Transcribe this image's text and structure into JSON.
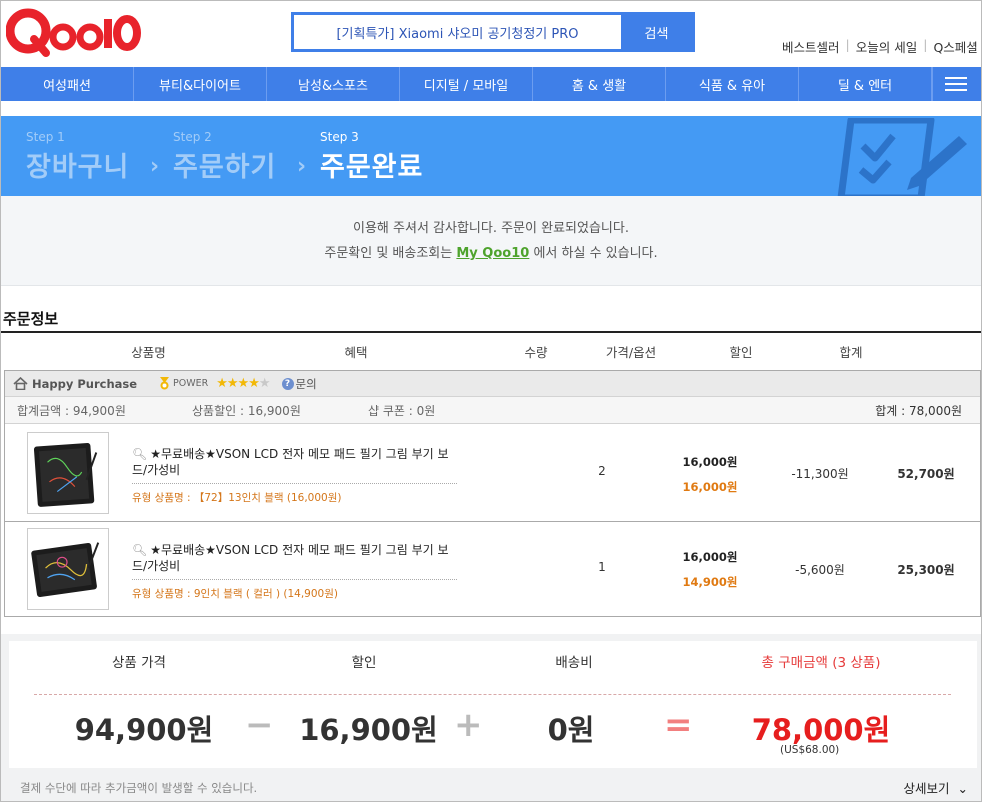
{
  "brand": {
    "logo_text": "Qoo10",
    "accent": "#3f7fe8",
    "logo_color": "#e8232b"
  },
  "search": {
    "value": "[기획특가] Xiaomi 샤오미 공기청정기 PRO",
    "button": "검색"
  },
  "top_links": [
    "베스트셀러",
    "오늘의 세일",
    "Q스페셜"
  ],
  "nav": [
    "여성패션",
    "뷰티&다이어트",
    "남성&스포츠",
    "디지털 / 모바일",
    "홈 & 생활",
    "식품 & 유아",
    "딜 & 엔터"
  ],
  "steps": [
    {
      "num": "Step 1",
      "title": "장바구니"
    },
    {
      "num": "Step 2",
      "title": "주문하기"
    },
    {
      "num": "Step 3",
      "title": "주문완료"
    }
  ],
  "thanks": {
    "line1": "이용해 주셔서 감사합니다. 주문이 완료되었습니다.",
    "line2_pre": "주문확인 및 배송조회는",
    "line2_link": "My Qoo10",
    "line2_post": "에서 하실 수 있습니다."
  },
  "order": {
    "title": "주문정보",
    "headers": [
      "상품명",
      "혜택",
      "수량",
      "가격/옵션",
      "할인",
      "합계"
    ],
    "shop": {
      "name": "Happy Purchase",
      "power": "POWER",
      "rating": 4,
      "rating_max": 5,
      "ask": "문의",
      "sum_total": "합계금액 : 94,900원",
      "sum_discount": "상품할인 : 16,900원",
      "sum_coupon": "샵 쿠폰 : 0원",
      "sum_grand": "합계 : 78,000원"
    },
    "items": [
      {
        "name": "★무료배송★VSON LCD 전자 메모 패드 필기 그림 부기 보드/가성비",
        "option": "유형 상품명 : 【72】13인치 블랙 (16,000원)",
        "qty": "2",
        "price": "16,000원",
        "sale_price": "16,000원",
        "discount": "-11,300원",
        "total": "52,700원"
      },
      {
        "name": "★무료배송★VSON LCD 전자 메모 패드 필기 그림 부기 보드/가성비",
        "option": "유형 상품명 : 9인치 블랙 ( 컬러 ) (14,900원)",
        "qty": "1",
        "price": "16,000원",
        "sale_price": "14,900원",
        "discount": "-5,600원",
        "total": "25,300원"
      }
    ]
  },
  "totals": {
    "labels": [
      "상품 가격",
      "할인",
      "배송비",
      "총 구매금액 (3 상품)"
    ],
    "values": [
      "94,900원",
      "16,900원",
      "0원",
      "78,000원"
    ],
    "ops": [
      "−",
      "+",
      "="
    ],
    "usd": "(US$68.00)",
    "note": "결제 수단에 따라 추가금액이 발생할 수 있습니다.",
    "detail": "상세보기"
  }
}
